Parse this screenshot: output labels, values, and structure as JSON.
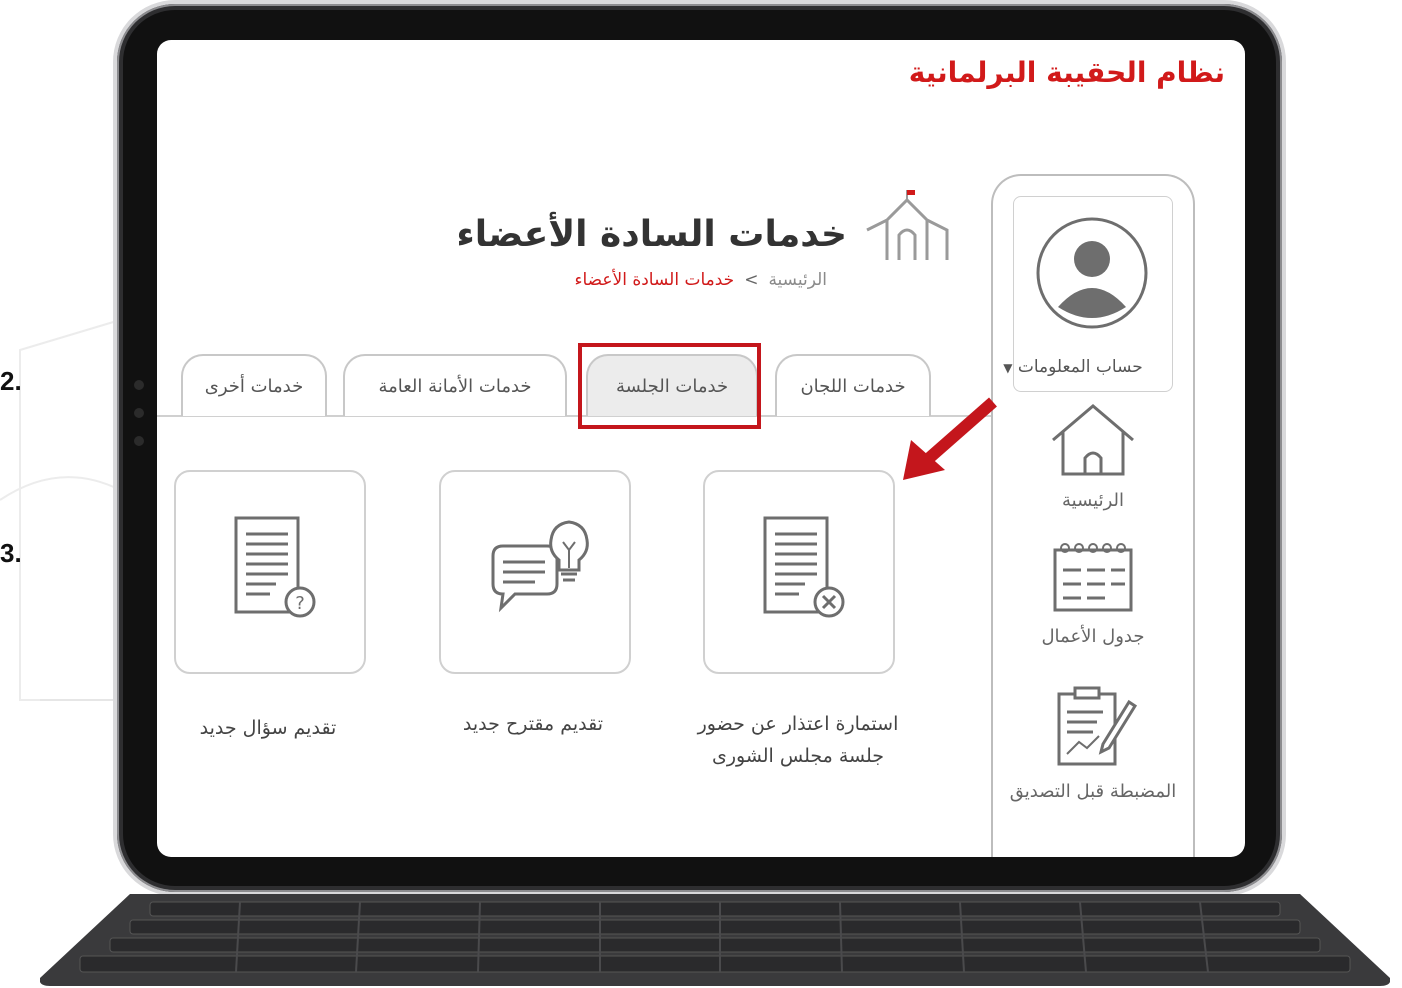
{
  "steps": [
    "2.",
    "3."
  ],
  "app": {
    "title": "نظام الحقيبة البرلمانية"
  },
  "page": {
    "title": "خدمات السادة الأعضاء"
  },
  "breadcrumb": {
    "home": "الرئيسية",
    "separator": ">",
    "current": "خدمات السادة الأعضاء"
  },
  "account": {
    "label": "حساب المعلومات"
  },
  "sidebar": {
    "items": [
      {
        "label": "الرئيسية",
        "icon": "home-icon"
      },
      {
        "label": "جدول الأعمال",
        "icon": "calendar-icon"
      },
      {
        "label": "المضبطة قبل التصديق",
        "icon": "clipboard-edit-icon"
      }
    ]
  },
  "tabs": [
    {
      "label": "خدمات اللجان",
      "active": false
    },
    {
      "label": "خدمات الجلسة",
      "active": true
    },
    {
      "label": "خدمات الأمانة العامة",
      "active": false
    },
    {
      "label": "خدمات أخرى",
      "active": false
    }
  ],
  "services": [
    {
      "label_line1": "استمارة اعتذار عن حضور",
      "label_line2": "جلسة مجلس الشورى",
      "icon": "document-cancel-icon"
    },
    {
      "label_line1": "تقديم مقترح جديد",
      "label_line2": "",
      "icon": "idea-chat-icon"
    },
    {
      "label_line1": "تقديم سؤال جديد",
      "label_line2": "",
      "icon": "document-question-icon"
    }
  ],
  "colors": {
    "accent": "#d11a1a",
    "highlight": "#c4161c",
    "text": "#444444",
    "border": "#d0d0d0"
  }
}
